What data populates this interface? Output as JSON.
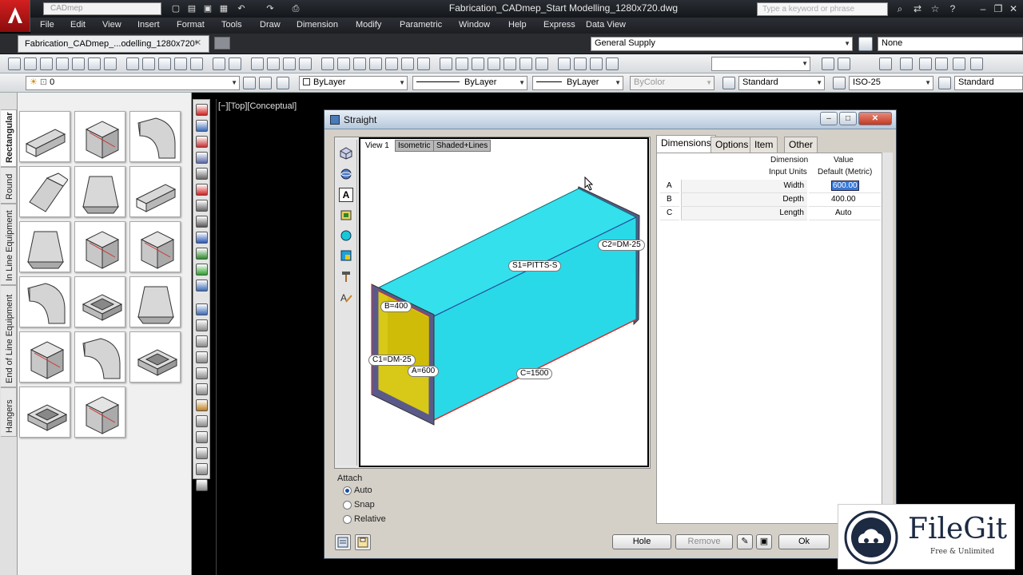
{
  "titlebar": {
    "workspace": "CADmep",
    "window_title": "Fabrication_CADmep_Start Modelling_1280x720.dwg",
    "help_search_placeholder": "Type a keyword or phrase"
  },
  "menubar": {
    "items": [
      "File",
      "Edit",
      "View",
      "Insert",
      "Format",
      "Tools",
      "Draw",
      "Dimension",
      "Modify",
      "Parametric",
      "Window",
      "Help",
      "Express",
      "Data View"
    ]
  },
  "tabs": {
    "document": "Fabrication_CADmep_...odelling_1280x720*",
    "supply_combo": "General Supply",
    "none_combo": "None"
  },
  "toolbar2": {
    "layer": "0",
    "color": "ByLayer",
    "linetype": "ByLayer",
    "lineweight": "ByLayer",
    "plotstyle": "ByColor",
    "text_style": "Standard",
    "dim_style": "ISO-25",
    "table_style": "Standard"
  },
  "palette": {
    "tabs": [
      "Rectangular",
      "Round",
      "In Line Equipment",
      "End of Line Equipment",
      "Hangers"
    ],
    "active_tab": "Rectangular"
  },
  "viewport": {
    "label": "[−][Top][Conceptual]"
  },
  "dialog": {
    "title": "Straight",
    "preview_tabs": [
      "View 1",
      "Isometric",
      "Shaded+Lines"
    ],
    "callouts": {
      "s1": "S1=PITTS-S",
      "c2": "C2=DM-25",
      "b": "B=400",
      "c1": "C1=DM-25",
      "a": "A=600",
      "c": "C=1500"
    },
    "right_tabs": [
      "Dimensions",
      "Options",
      "Item",
      "Other"
    ],
    "table": {
      "header_dimension": "Dimension",
      "header_value": "Value",
      "header_input_units": "Input Units",
      "header_default": "Default (Metric)",
      "rows": [
        {
          "key": "A",
          "name": "Width",
          "value": "600.00"
        },
        {
          "key": "B",
          "name": "Depth",
          "value": "400.00"
        },
        {
          "key": "C",
          "name": "Length",
          "value": "Auto"
        }
      ]
    },
    "attach": {
      "label": "Attach",
      "options": [
        "Auto",
        "Snap",
        "Relative"
      ],
      "selected": "Auto"
    },
    "buttons": {
      "hole": "Hole",
      "remove": "Remove",
      "ok": "Ok"
    }
  },
  "watermark": {
    "name": "FileGit",
    "tagline": "Free & Unlimited"
  },
  "colors": {
    "duct_face": "#33e0ec",
    "duct_end": "#d2c616",
    "flange": "#5a5a8a",
    "accent_red": "#c81e1e"
  }
}
